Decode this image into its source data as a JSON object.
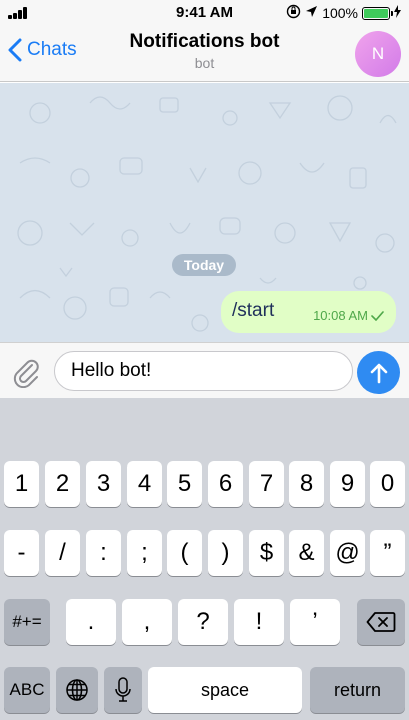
{
  "status_bar": {
    "time": "9:41 AM",
    "battery": "100%"
  },
  "header": {
    "back_label": "Chats",
    "title": "Notifications bot",
    "subtitle": "bot",
    "avatar_initial": "N"
  },
  "chat": {
    "date_label": "Today",
    "messages": [
      {
        "text": "/start",
        "time": "10:08 AM"
      }
    ]
  },
  "composer": {
    "input_value": "Hello bot!"
  },
  "keyboard": {
    "row1": [
      "1",
      "2",
      "3",
      "4",
      "5",
      "6",
      "7",
      "8",
      "9",
      "0"
    ],
    "row2": [
      "-",
      "/",
      ":",
      ";",
      "(",
      ")",
      "$",
      "&",
      "@",
      "”"
    ],
    "row3": [
      "#+=",
      ".",
      ",",
      "?",
      "!",
      "’"
    ],
    "row4": [
      "ABC",
      "space",
      "return"
    ]
  },
  "colors": {
    "accent": "#1a7cf5",
    "bubble": "#e1fec6",
    "send": "#2f8bf2",
    "battery": "#3ecb5b"
  }
}
